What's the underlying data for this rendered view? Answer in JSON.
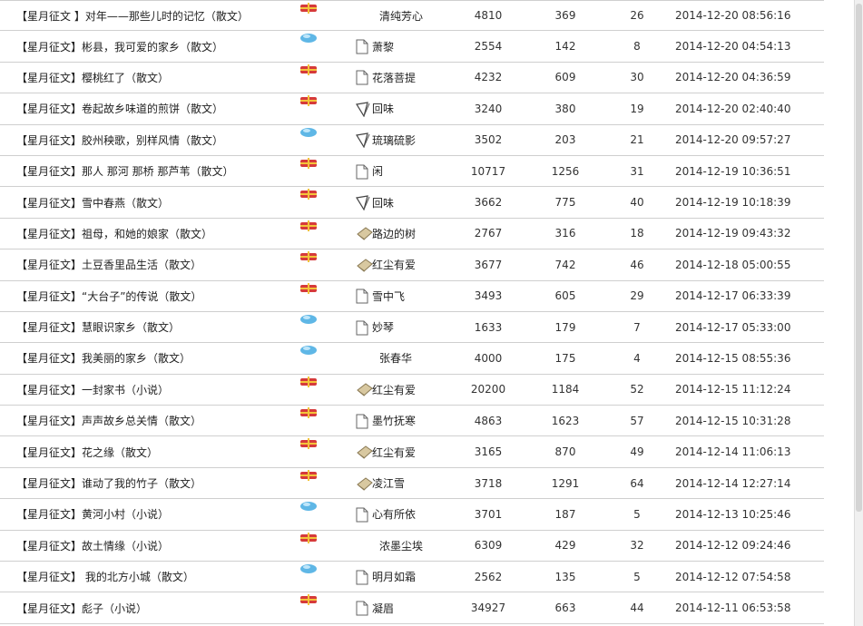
{
  "rows": [
    {
      "title": "【星月征文 】对年——那些儿时的记忆（散文）",
      "status": "hot-flag-icon",
      "author_icon": "",
      "author": "清纯芳心",
      "views": "4810",
      "replies": "369",
      "score": "26",
      "date": "2014-12-20 08:56:16"
    },
    {
      "title": "【星月征文】彬县，我可爱的家乡（散文）",
      "status": "blue-gem-icon",
      "author_icon": "document-icon",
      "author": "萧黎",
      "views": "2554",
      "replies": "142",
      "score": "8",
      "date": "2014-12-20 04:54:13"
    },
    {
      "title": "【星月征文】樱桃红了（散文）",
      "status": "hot-flag-icon",
      "author_icon": "document-icon",
      "author": "花落菩提",
      "views": "4232",
      "replies": "609",
      "score": "30",
      "date": "2014-12-20 04:36:59"
    },
    {
      "title": "【星月征文】卷起故乡味道的煎饼（散文）",
      "status": "hot-flag-icon",
      "author_icon": "quill-icon",
      "author": "回味",
      "views": "3240",
      "replies": "380",
      "score": "19",
      "date": "2014-12-20 02:40:40"
    },
    {
      "title": "【星月征文】胶州秧歌，别样风情（散文）",
      "status": "blue-gem-icon",
      "author_icon": "quill-icon",
      "author": "琉璃硫影",
      "views": "3502",
      "replies": "203",
      "score": "21",
      "date": "2014-12-20 09:57:27"
    },
    {
      "title": "【星月征文】那人 那河 那桥 那芦苇（散文）",
      "status": "hot-flag-icon",
      "author_icon": "document-icon",
      "author": "闲",
      "views": "10717",
      "replies": "1256",
      "score": "31",
      "date": "2014-12-19 10:36:51"
    },
    {
      "title": "【星月征文】雪中春燕（散文）",
      "status": "hot-flag-icon",
      "author_icon": "quill-icon",
      "author": "回味",
      "views": "3662",
      "replies": "775",
      "score": "40",
      "date": "2014-12-19 10:18:39"
    },
    {
      "title": "【星月征文】祖母，和她的娘家（散文）",
      "status": "hot-flag-icon",
      "author_icon": "book-icon",
      "author": "路边的树",
      "views": "2767",
      "replies": "316",
      "score": "18",
      "date": "2014-12-19 09:43:32"
    },
    {
      "title": "【星月征文】土豆香里品生活（散文）",
      "status": "hot-flag-icon",
      "author_icon": "book-icon",
      "author": "红尘有爱",
      "views": "3677",
      "replies": "742",
      "score": "46",
      "date": "2014-12-18 05:00:55"
    },
    {
      "title": "【星月征文】“大台子”的传说（散文）",
      "status": "hot-flag-icon",
      "author_icon": "document-icon",
      "author": "雪中飞",
      "views": "3493",
      "replies": "605",
      "score": "29",
      "date": "2014-12-17 06:33:39"
    },
    {
      "title": "【星月征文】慧眼识家乡（散文）",
      "status": "blue-gem-icon",
      "author_icon": "document-icon",
      "author": "妙琴",
      "views": "1633",
      "replies": "179",
      "score": "7",
      "date": "2014-12-17 05:33:00"
    },
    {
      "title": "【星月征文】我美丽的家乡（散文）",
      "status": "blue-gem-icon",
      "author_icon": "",
      "author": "张春华",
      "views": "4000",
      "replies": "175",
      "score": "4",
      "date": "2014-12-15 08:55:36"
    },
    {
      "title": "【星月征文】一封家书（小说）",
      "status": "hot-flag-icon",
      "author_icon": "book-icon",
      "author": "红尘有爱",
      "views": "20200",
      "replies": "1184",
      "score": "52",
      "date": "2014-12-15 11:12:24"
    },
    {
      "title": "【星月征文】声声故乡总关情（散文）",
      "status": "hot-flag-icon",
      "author_icon": "document-icon",
      "author": "墨竹抚寒",
      "views": "4863",
      "replies": "1623",
      "score": "57",
      "date": "2014-12-15 10:31:28"
    },
    {
      "title": "【星月征文】花之缘（散文）",
      "status": "hot-flag-icon",
      "author_icon": "book-icon",
      "author": "红尘有爱",
      "views": "3165",
      "replies": "870",
      "score": "49",
      "date": "2014-12-14 11:06:13"
    },
    {
      "title": "【星月征文】谁动了我的竹子（散文）",
      "status": "hot-flag-icon",
      "author_icon": "book-icon",
      "author": "凌江雪",
      "views": "3718",
      "replies": "1291",
      "score": "64",
      "date": "2014-12-14 12:27:14"
    },
    {
      "title": "【星月征文】黄河小村（小说）",
      "status": "blue-gem-icon",
      "author_icon": "document-icon",
      "author": "心有所依",
      "views": "3701",
      "replies": "187",
      "score": "5",
      "date": "2014-12-13 10:25:46"
    },
    {
      "title": "【星月征文】故土情缘（小说）",
      "status": "hot-flag-icon",
      "author_icon": "",
      "author": "浓墨尘埃",
      "views": "6309",
      "replies": "429",
      "score": "32",
      "date": "2014-12-12 09:24:46"
    },
    {
      "title": "【星月征文】 我的北方小城（散文）",
      "status": "blue-gem-icon",
      "author_icon": "document-icon",
      "author": "明月如霜",
      "views": "2562",
      "replies": "135",
      "score": "5",
      "date": "2014-12-12 07:54:58"
    },
    {
      "title": "【星月征文】彪子（小说）",
      "status": "hot-flag-icon",
      "author_icon": "document-icon",
      "author": "凝眉",
      "views": "34927",
      "replies": "663",
      "score": "44",
      "date": "2014-12-11 06:53:58"
    }
  ],
  "colors": {
    "flag_red": "#d63a3a",
    "flag_yellow": "#f3c43a",
    "gem_blue": "#5fb7e6",
    "divider": "#cfcfcf"
  }
}
